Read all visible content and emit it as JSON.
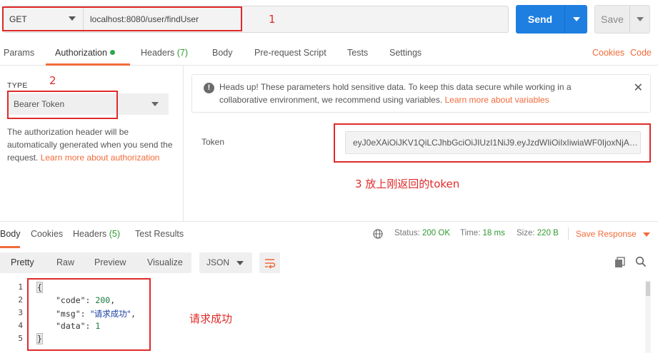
{
  "request": {
    "method": "GET",
    "url": "localhost:8080/user/findUser",
    "send_label": "Send",
    "save_label": "Save"
  },
  "request_tabs": [
    {
      "label": "Params"
    },
    {
      "label": "Authorization",
      "active": true,
      "has_dot": true
    },
    {
      "label": "Headers",
      "count": "(7)"
    },
    {
      "label": "Body"
    },
    {
      "label": "Pre-request Script"
    },
    {
      "label": "Tests"
    },
    {
      "label": "Settings"
    }
  ],
  "request_links": {
    "cookies": "Cookies",
    "code": "Code"
  },
  "auth": {
    "type_label": "TYPE",
    "type_value": "Bearer Token",
    "description": "The authorization header will be automatically generated when you send the request.",
    "learn_more": "Learn more about authorization"
  },
  "notice": {
    "text": "Heads up! These parameters hold sensitive data. To keep this data secure while working in a collaborative environment, we recommend using variables.",
    "link": "Learn more about variables"
  },
  "token": {
    "label": "Token",
    "value": "eyJ0eXAiOiJKV1QiLCJhbGciOiJIUzI1NiJ9.eyJzdWIiOiIxIiwiaWF0IjoxNjAx..."
  },
  "response_tabs": [
    {
      "label": "Body",
      "active": true
    },
    {
      "label": "Cookies"
    },
    {
      "label": "Headers",
      "count": "(5)"
    },
    {
      "label": "Test Results"
    }
  ],
  "response_stats": {
    "status_label": "Status:",
    "status_value": "200 OK",
    "time_label": "Time:",
    "time_value": "18 ms",
    "size_label": "Size:",
    "size_value": "220 B",
    "save_response": "Save Response"
  },
  "view_modes": [
    "Pretty",
    "Raw",
    "Preview",
    "Visualize"
  ],
  "format": "JSON",
  "code": {
    "line_numbers": [
      "1",
      "2",
      "3",
      "4",
      "5"
    ],
    "open_brace": "{",
    "close_brace": "}",
    "fields": [
      {
        "key": "\"code\"",
        "value": "200",
        "type": "number",
        "trail": ","
      },
      {
        "key": "\"msg\"",
        "value": "\"请求成功\"",
        "type": "string",
        "trail": ","
      },
      {
        "key": "\"data\"",
        "value": "1",
        "type": "number",
        "trail": ""
      }
    ]
  },
  "annotations": {
    "a1": "1",
    "a2": "2",
    "a3": "3 放上刚返回的token",
    "a4": "请求成功"
  },
  "colors": {
    "accent": "#f26b3a",
    "send": "#1f7fe0",
    "success": "#2f9a2f",
    "annotation": "#e02a2a"
  }
}
